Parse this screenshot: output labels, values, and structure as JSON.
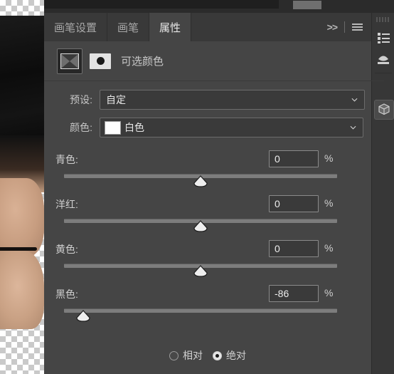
{
  "app": {
    "panel_title": "属性"
  },
  "tabs": [
    {
      "label": "画笔设置",
      "active": false,
      "name": "tab-brush-settings"
    },
    {
      "label": "画笔",
      "active": false,
      "name": "tab-brush"
    },
    {
      "label": "属性",
      "active": true,
      "name": "tab-properties"
    }
  ],
  "tab_tools": {
    "overflow_label": ">>",
    "menu_icon": "hamburger-menu-icon"
  },
  "adjustment": {
    "layer_icon": "selective-color-adjustment-icon",
    "mask_icon": "layer-mask-thumbnail-icon",
    "title": "可选颜色"
  },
  "preset": {
    "label": "预设:",
    "value": "自定",
    "chevron": "chevron-down-icon"
  },
  "color": {
    "label": "颜色:",
    "value": "白色",
    "swatch_hex": "#ffffff",
    "chevron": "chevron-down-icon"
  },
  "sliders": [
    {
      "label": "青色:",
      "value": "0",
      "unit": "%",
      "percent": 50,
      "name": "cyan"
    },
    {
      "label": "洋红:",
      "value": "0",
      "unit": "%",
      "percent": 50,
      "name": "magenta"
    },
    {
      "label": "黄色:",
      "value": "0",
      "unit": "%",
      "percent": 50,
      "name": "yellow"
    },
    {
      "label": "黑色:",
      "value": "-86",
      "unit": "%",
      "percent": 7,
      "name": "black"
    }
  ],
  "method": {
    "relative": {
      "label": "相对",
      "selected": false
    },
    "absolute": {
      "label": "绝对",
      "selected": true
    }
  },
  "dock": [
    {
      "name": "dock-icon-layers",
      "selected": false
    },
    {
      "name": "dock-icon-adjustments",
      "selected": false
    },
    {
      "name": "dock-icon-3d",
      "selected": true
    }
  ],
  "colors": {
    "panel_bg": "#454545",
    "tab_bg": "#393939",
    "accent_text": "#e8e8e8",
    "track": "#7d7d7d"
  }
}
